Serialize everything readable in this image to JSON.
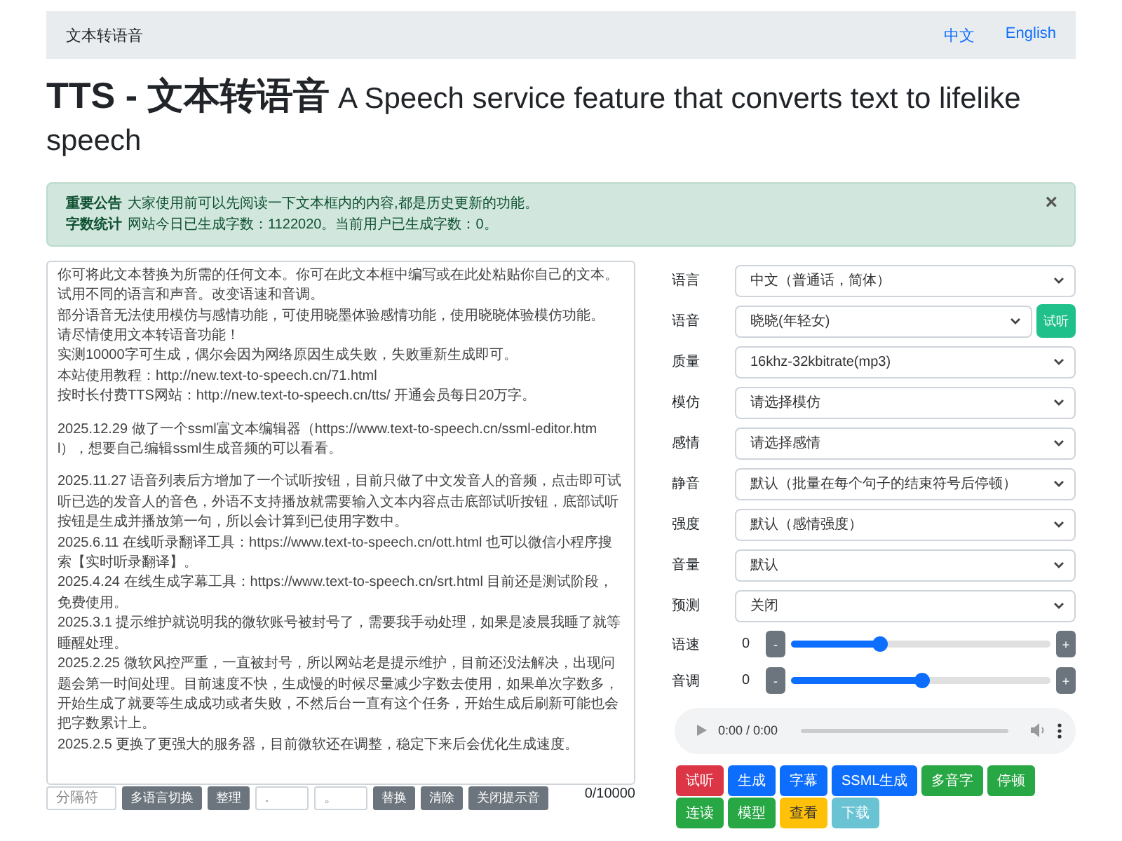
{
  "navbar": {
    "brand": "文本转语音",
    "links": [
      {
        "label": "中文"
      },
      {
        "label": "English"
      }
    ]
  },
  "heading": "**TTS - 文本转语音** A Speech service feature that converts text to lifelike speech",
  "alert": {
    "lines": [
      {
        "label": "重要公告",
        "text": "大家使用前可以先阅读一下文本框内的内容,都是历史更新的功能。"
      },
      {
        "label": "字数统计",
        "text": "网站今日已生成字数：1122020。当前用户已生成字数：0。"
      }
    ],
    "close": "×"
  },
  "editor": {
    "paragraphs": [
      [
        "你可将此文本替换为所需的任何文本。你可在此文本框中编写或在此处粘贴你自己的文本。试用不同的语言和声音。改变语速和音调。",
        "部分语音无法使用模仿与感情功能，可使用晓墨体验感情功能，使用晓晓体验模仿功能。",
        "请尽情使用文本转语音功能！",
        "实测10000字可生成，偶尔会因为网络原因生成失败，失败重新生成即可。",
        "本站使用教程：http://new.text-to-speech.cn/71.html",
        "按时长付费TTS网站：http://new.text-to-speech.cn/tts/  开通会员每日20万字。"
      ],
      [
        "2025.12.29 做了一个ssml富文本编辑器（https://www.text-to-speech.cn/ssml-editor.html），想要自己编辑ssml生成音频的可以看看。"
      ],
      [
        "2025.11.27 语音列表后方增加了一个试听按钮，目前只做了中文发音人的音频，点击即可试听已选的发音人的音色，外语不支持播放就需要输入文本内容点击底部试听按钮，底部试听按钮是生成并播放第一句，所以会计算到已使用字数中。",
        "2025.6.11 在线听录翻译工具：https://www.text-to-speech.cn/ott.html 也可以微信小程序搜索【实时听录翻译】。",
        "2025.4.24 在线生成字幕工具：https://www.text-to-speech.cn/srt.html 目前还是测试阶段，免费使用。",
        "2025.3.1 提示维护就说明我的微软账号被封号了，需要我手动处理，如果是凌晨我睡了就等睡醒处理。",
        "2025.2.25 微软风控严重，一直被封号，所以网站老是提示维护，目前还没法解决，出现问题会第一时间处理。目前速度不快，生成慢的时候尽量减少字数去使用，如果单次字数多，开始生成了就要等生成成功或者失败，不然后台一直有这个任务，开始生成后刷新可能也会把字数累计上。",
        "2025.2.5 更换了更强大的服务器，目前微软还在调整，稳定下来后会优化生成速度。"
      ]
    ],
    "toolbar": [
      {
        "kind": "input",
        "placeholder": "分隔符"
      },
      {
        "kind": "button",
        "label": "多语言切换"
      },
      {
        "kind": "button",
        "label": "整理"
      },
      {
        "kind": "input",
        "placeholder": "."
      },
      {
        "kind": "input",
        "placeholder": "。"
      },
      {
        "kind": "button",
        "label": "替换"
      },
      {
        "kind": "button",
        "label": "清除"
      },
      {
        "kind": "button",
        "label": "关闭提示音"
      }
    ],
    "count": "0/10000"
  },
  "settings": [
    {
      "kind": "select",
      "label": "语言",
      "value": "中文（普通话，简体）"
    },
    {
      "kind": "select",
      "label": "语音",
      "value": "晓晓(年轻女)",
      "button": "试听"
    },
    {
      "kind": "select",
      "label": "质量",
      "value": "16khz-32kbitrate(mp3)"
    },
    {
      "kind": "select",
      "label": "模仿",
      "value": "请选择模仿"
    },
    {
      "kind": "select",
      "label": "感情",
      "value": "请选择感情"
    },
    {
      "kind": "select",
      "label": "静音",
      "value": "默认（批量在每个句子的结束符号后停顿）"
    },
    {
      "kind": "select",
      "label": "强度",
      "value": "默认（感情强度）"
    },
    {
      "kind": "select",
      "label": "音量",
      "value": "默认"
    },
    {
      "kind": "select",
      "label": "预测",
      "value": "关闭"
    },
    {
      "kind": "slider",
      "label": "语速",
      "reading": "0",
      "minus": "-",
      "plus": "+",
      "level": 0.34
    },
    {
      "kind": "slider",
      "label": "音调",
      "reading": "0",
      "minus": "-",
      "plus": "+",
      "level": 0.5
    }
  ],
  "player": {
    "time": "0:00 / 0:00"
  },
  "actions": [
    {
      "label": "试听",
      "kind": "danger"
    },
    {
      "label": "生成",
      "kind": "primary"
    },
    {
      "label": "字幕",
      "kind": "primary"
    },
    {
      "label": "SSML生成",
      "kind": "primary"
    },
    {
      "label": "多音字",
      "kind": "success"
    },
    {
      "label": "停顿",
      "kind": "success"
    },
    {
      "label": "连读",
      "kind": "success"
    },
    {
      "label": "模型",
      "kind": "success"
    },
    {
      "label": "查看",
      "kind": "warning"
    },
    {
      "label": "下载",
      "kind": "info"
    }
  ]
}
